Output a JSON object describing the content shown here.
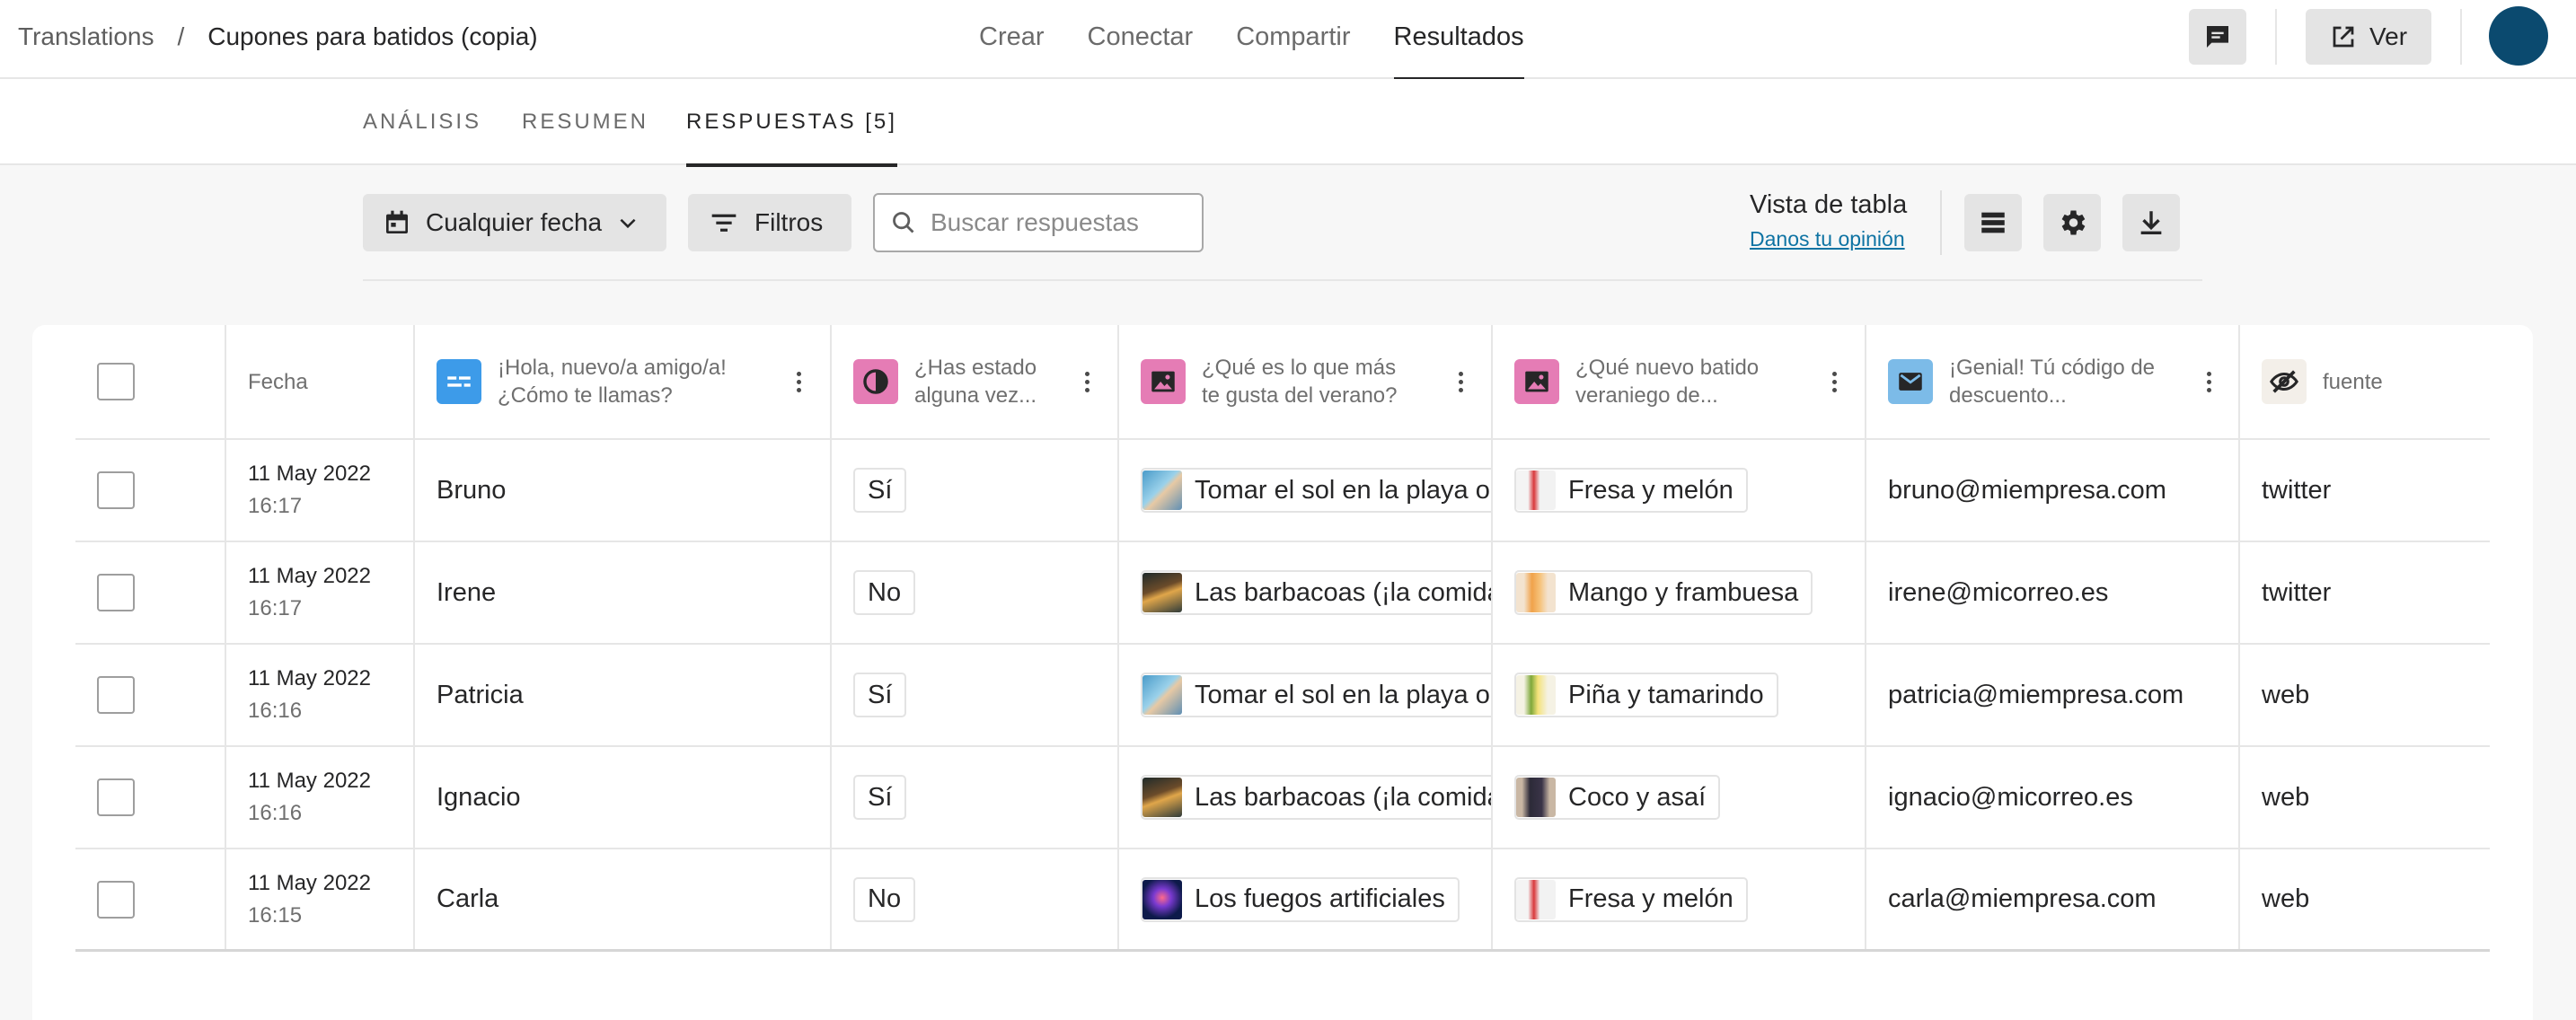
{
  "breadcrumb": {
    "root": "Translations",
    "separator": "/",
    "current": "Cupones para batidos (copia)"
  },
  "top_nav": [
    {
      "label": "Crear",
      "active": false
    },
    {
      "label": "Conectar",
      "active": false
    },
    {
      "label": "Compartir",
      "active": false
    },
    {
      "label": "Resultados",
      "active": true
    }
  ],
  "view_button": {
    "label": "Ver",
    "icon": "external-link-icon"
  },
  "sub_tabs": [
    {
      "label": "ANÁLISIS",
      "active": false
    },
    {
      "label": "RESUMEN",
      "active": false
    },
    {
      "label": "RESPUESTAS [5]",
      "active": true
    }
  ],
  "toolbar": {
    "date_filter": "Cualquier fecha",
    "filters": "Filtros",
    "search_placeholder": "Buscar respuestas",
    "view_mode": "Vista de tabla",
    "feedback_link": "Danos tu opinión"
  },
  "columns": [
    {
      "label": "Fecha",
      "icon": ""
    },
    {
      "label": "¡Hola, nuevo/a amigo/a! ¿Cómo te llamas?",
      "line1": "¡Hola, nuevo/a amigo/a!",
      "line2": "¿Cómo te llamas?",
      "icon": "short-text-icon",
      "color": "#3d9be9"
    },
    {
      "label": "¿Has estado alguna vez...",
      "line1": "¿Has estado",
      "line2": "alguna vez...",
      "icon": "yes-no-icon",
      "color": "#e57cb5"
    },
    {
      "label": "¿Qué es lo que más te gusta del verano?",
      "line1": "¿Qué es lo que más",
      "line2": "te gusta del verano?",
      "icon": "picture-choice-icon",
      "color": "#e57cb5"
    },
    {
      "label": "¿Qué nuevo batido veraniego de...",
      "line1": "¿Qué nuevo batido",
      "line2": "veraniego de...",
      "icon": "picture-choice-icon",
      "color": "#e57cb5"
    },
    {
      "label": "¡Genial! Tú código de descuento...",
      "line1": "¡Genial! Tú código de",
      "line2": "descuento...",
      "icon": "email-icon",
      "color": "#7cbbe8"
    },
    {
      "label": "fuente",
      "icon": "hidden-eye-icon"
    }
  ],
  "rows": [
    {
      "date": "11 May 2022",
      "time": "16:17",
      "name": "Bruno",
      "visited": "Sí",
      "summer": "Tomar el sol en la playa o",
      "summer_thumb": "beach",
      "shake": "Fresa y melón",
      "shake_thumb": "strawberry",
      "email": "bruno@miempresa.com",
      "source": "twitter"
    },
    {
      "date": "11 May 2022",
      "time": "16:17",
      "name": "Irene",
      "visited": "No",
      "summer": "Las barbacoas (¡la comida",
      "summer_thumb": "bbq",
      "shake": "Mango y frambuesa",
      "shake_thumb": "mango",
      "email": "irene@micorreo.es",
      "source": "twitter"
    },
    {
      "date": "11 May 2022",
      "time": "16:16",
      "name": "Patricia",
      "visited": "Sí",
      "summer": "Tomar el sol en la playa o",
      "summer_thumb": "beach",
      "shake": "Piña y tamarindo",
      "shake_thumb": "pineapple",
      "email": "patricia@miempresa.com",
      "source": "web"
    },
    {
      "date": "11 May 2022",
      "time": "16:16",
      "name": "Ignacio",
      "visited": "Sí",
      "summer": "Las barbacoas (¡la comida",
      "summer_thumb": "bbq",
      "shake": "Coco y asaí",
      "shake_thumb": "coconut",
      "email": "ignacio@micorreo.es",
      "source": "web"
    },
    {
      "date": "11 May 2022",
      "time": "16:15",
      "name": "Carla",
      "visited": "No",
      "summer": "Los fuegos artificiales",
      "summer_thumb": "fireworks",
      "shake": "Fresa y melón",
      "shake_thumb": "strawberry",
      "email": "carla@miempresa.com",
      "source": "web"
    }
  ],
  "colors": {
    "accent": "#262627",
    "link": "#0e73a3",
    "avatar": "#0b4a6f",
    "button_bg": "#e4e4e4"
  }
}
